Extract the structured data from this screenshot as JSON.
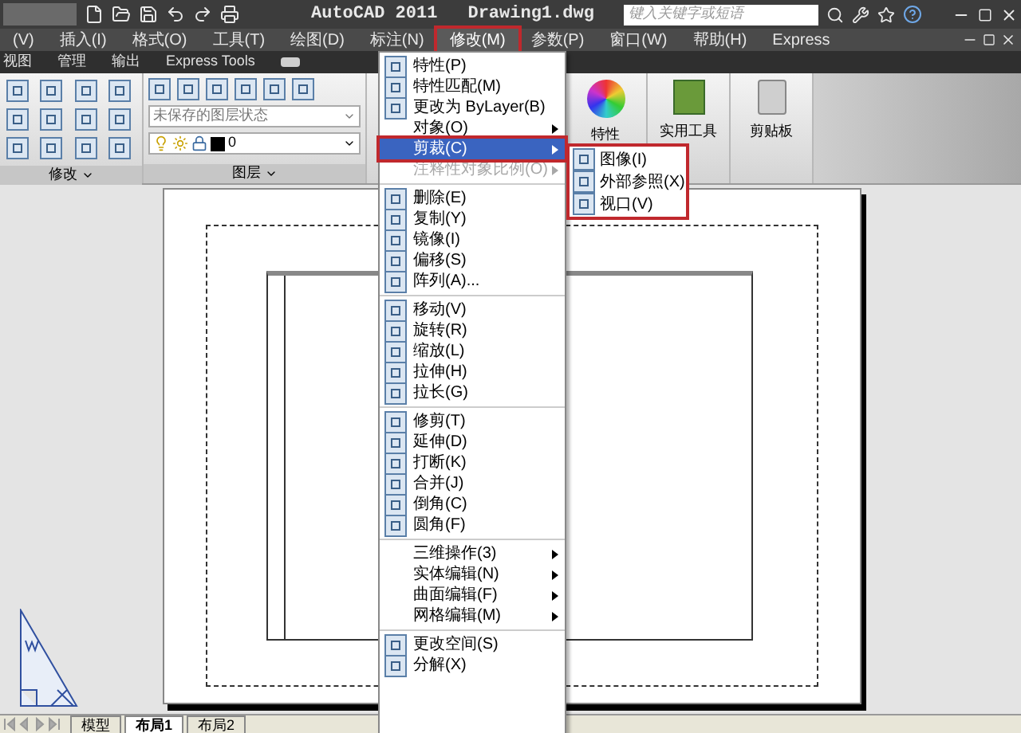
{
  "title_bar": {
    "app": "AutoCAD 2011",
    "document": "Drawing1.dwg",
    "search": {
      "placeholder": "键入关键字或短语"
    }
  },
  "menu_bar": [
    {
      "label": "(V)",
      "selected": false
    },
    {
      "label": "插入(I)",
      "selected": false
    },
    {
      "label": "格式(O)",
      "selected": false
    },
    {
      "label": "工具(T)",
      "selected": false
    },
    {
      "label": "绘图(D)",
      "selected": false
    },
    {
      "label": "标注(N)",
      "selected": false
    },
    {
      "label": "修改(M)",
      "selected": true
    },
    {
      "label": "参数(P)",
      "selected": false
    },
    {
      "label": "窗口(W)",
      "selected": false
    },
    {
      "label": "帮助(H)",
      "selected": false
    },
    {
      "label": "Express",
      "selected": false
    }
  ],
  "ribbon_tabs": [
    {
      "label": "视图",
      "selected": false
    },
    {
      "label": "管理",
      "selected": false
    },
    {
      "label": "输出",
      "selected": false
    },
    {
      "label": "Express Tools",
      "selected": false
    }
  ],
  "ribbon": {
    "layer_state": "未保存的图层状态",
    "layer": "0",
    "panels": [
      {
        "label": "修改"
      },
      {
        "label": "图层"
      }
    ],
    "big_buttons": [
      {
        "label": "特性"
      },
      {
        "label": "实用工具"
      },
      {
        "label": "剪贴板"
      }
    ]
  },
  "menu": {
    "groups": [
      [
        {
          "kind": "command",
          "label": "特性(P)",
          "selected": false,
          "disabled": false
        },
        {
          "kind": "command",
          "label": "特性匹配(M)",
          "selected": false,
          "disabled": false
        },
        {
          "kind": "command",
          "label": "更改为 ByLayer(B)",
          "selected": false,
          "disabled": false
        },
        {
          "kind": "submenu",
          "label": "对象(O)",
          "selected": false,
          "disabled": false
        },
        {
          "kind": "submenu",
          "label": "剪裁(C)",
          "selected": true,
          "disabled": false
        },
        {
          "kind": "submenu",
          "label": "注释性对象比例(O)",
          "selected": false,
          "disabled": true
        }
      ],
      [
        {
          "kind": "command",
          "label": "删除(E)",
          "selected": false,
          "disabled": false
        },
        {
          "kind": "command",
          "label": "复制(Y)",
          "selected": false,
          "disabled": false
        },
        {
          "kind": "command",
          "label": "镜像(I)",
          "selected": false,
          "disabled": false
        },
        {
          "kind": "command",
          "label": "偏移(S)",
          "selected": false,
          "disabled": false
        },
        {
          "kind": "command",
          "label": "阵列(A)...",
          "selected": false,
          "disabled": false
        }
      ],
      [
        {
          "kind": "command",
          "label": "移动(V)",
          "selected": false,
          "disabled": false
        },
        {
          "kind": "command",
          "label": "旋转(R)",
          "selected": false,
          "disabled": false
        },
        {
          "kind": "command",
          "label": "缩放(L)",
          "selected": false,
          "disabled": false
        },
        {
          "kind": "command",
          "label": "拉伸(H)",
          "selected": false,
          "disabled": false
        },
        {
          "kind": "command",
          "label": "拉长(G)",
          "selected": false,
          "disabled": false
        }
      ],
      [
        {
          "kind": "command",
          "label": "修剪(T)",
          "selected": false,
          "disabled": false
        },
        {
          "kind": "command",
          "label": "延伸(D)",
          "selected": false,
          "disabled": false
        },
        {
          "kind": "command",
          "label": "打断(K)",
          "selected": false,
          "disabled": false
        },
        {
          "kind": "command",
          "label": "合并(J)",
          "selected": false,
          "disabled": false
        },
        {
          "kind": "command",
          "label": "倒角(C)",
          "selected": false,
          "disabled": false
        },
        {
          "kind": "command",
          "label": "圆角(F)",
          "selected": false,
          "disabled": false
        }
      ],
      [
        {
          "kind": "submenu",
          "label": "三维操作(3)",
          "selected": false,
          "disabled": false
        },
        {
          "kind": "submenu",
          "label": "实体编辑(N)",
          "selected": false,
          "disabled": false
        },
        {
          "kind": "submenu",
          "label": "曲面编辑(F)",
          "selected": false,
          "disabled": false
        },
        {
          "kind": "submenu",
          "label": "网格编辑(M)",
          "selected": false,
          "disabled": false
        }
      ],
      [
        {
          "kind": "command",
          "label": "更改空间(S)",
          "selected": false,
          "disabled": false
        },
        {
          "kind": "command",
          "label": "分解(X)",
          "selected": false,
          "disabled": false
        }
      ]
    ]
  },
  "submenu": [
    {
      "label": "图像(I)"
    },
    {
      "label": "外部参照(X)"
    },
    {
      "label": "视口(V)"
    }
  ],
  "layout_tabs": [
    {
      "label": "模型",
      "selected": false
    },
    {
      "label": "布局1",
      "selected": true
    },
    {
      "label": "布局2",
      "selected": false
    }
  ]
}
